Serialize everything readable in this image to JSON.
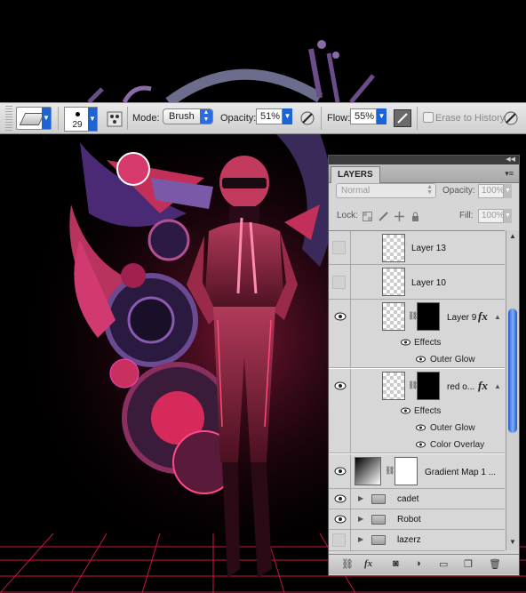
{
  "options_bar": {
    "brush_size": "29",
    "mode_label": "Mode:",
    "mode_value": "Brush",
    "opacity_label": "Opacity:",
    "opacity_value": "51%",
    "flow_label": "Flow:",
    "flow_value": "55%",
    "erase_history_label": "Erase to History"
  },
  "layers_panel": {
    "tab_label": "LAYERS",
    "blend_mode": "Normal",
    "opacity_label": "Opacity:",
    "opacity_value": "100%",
    "lock_label": "Lock:",
    "fill_label": "Fill:",
    "fill_value": "100%",
    "layers": [
      {
        "name": "Layer 13",
        "visible": false
      },
      {
        "name": "Layer 10",
        "visible": false
      },
      {
        "name": "Layer 9",
        "visible": true
      },
      {
        "name": "Effects"
      },
      {
        "name": "Outer Glow"
      },
      {
        "name": "red o...",
        "visible": true
      },
      {
        "name": "Effects"
      },
      {
        "name": "Outer Glow"
      },
      {
        "name": "Color Overlay"
      },
      {
        "name": "Gradient Map 1 ...",
        "visible": true
      },
      {
        "name": "cadet",
        "visible": true
      },
      {
        "name": "Robot",
        "visible": true
      },
      {
        "name": "lazerz",
        "visible": false
      }
    ]
  },
  "colors": {
    "accent_blue": "#1c64d4",
    "neon_pink": "#ff2d6f",
    "art_purple": "#4a2a74"
  }
}
